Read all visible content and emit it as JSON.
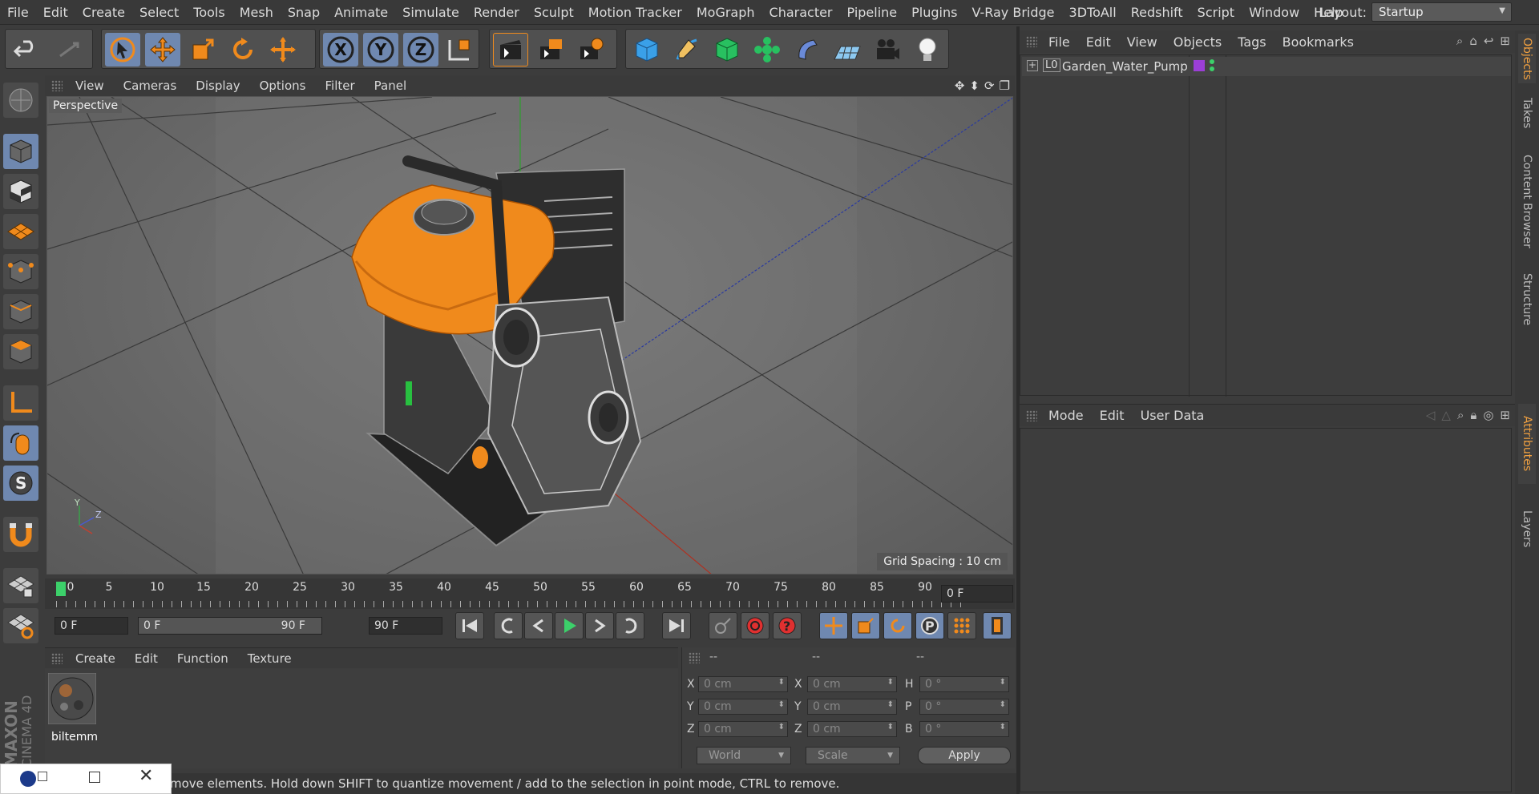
{
  "menubar": {
    "items": [
      "File",
      "Edit",
      "Create",
      "Select",
      "Tools",
      "Mesh",
      "Snap",
      "Animate",
      "Simulate",
      "Render",
      "Sculpt",
      "Motion Tracker",
      "MoGraph",
      "Character",
      "Pipeline",
      "Plugins",
      "V-Ray Bridge",
      "3DToAll",
      "Redshift",
      "Script",
      "Window",
      "Help"
    ],
    "layout_label": "Layout:",
    "layout_value": "Startup"
  },
  "toolbar": {
    "axis_x": "X",
    "axis_y": "Y",
    "axis_z": "Z"
  },
  "viewport": {
    "menu": [
      "View",
      "Cameras",
      "Display",
      "Options",
      "Filter",
      "Panel"
    ],
    "label": "Perspective",
    "grid_spacing": "Grid Spacing : 10 cm",
    "axis_y": "Y",
    "axis_z": "Z"
  },
  "timeline": {
    "ticks": [
      "0",
      "5",
      "10",
      "15",
      "20",
      "25",
      "30",
      "35",
      "40",
      "45",
      "50",
      "55",
      "60",
      "65",
      "70",
      "75",
      "80",
      "85",
      "90"
    ],
    "current_frame": "0 F"
  },
  "transport": {
    "start_frame": "0 F",
    "range_start": "0 F",
    "range_end": "90 F",
    "end_frame": "90 F"
  },
  "material_manager": {
    "menu": [
      "Create",
      "Edit",
      "Function",
      "Texture"
    ],
    "material_name": "biltemm"
  },
  "coordinates": {
    "headers": [
      "--",
      "--",
      "--"
    ],
    "rows": [
      {
        "l1": "X",
        "v1": "0 cm",
        "l2": "X",
        "v2": "0 cm",
        "l3": "H",
        "v3": "0 °"
      },
      {
        "l1": "Y",
        "v1": "0 cm",
        "l2": "Y",
        "v2": "0 cm",
        "l3": "P",
        "v3": "0 °"
      },
      {
        "l1": "Z",
        "v1": "0 cm",
        "l2": "Z",
        "v2": "0 cm",
        "l3": "B",
        "v3": "0 °"
      }
    ],
    "world": "World",
    "scale": "Scale",
    "apply": "Apply"
  },
  "status": {
    "text": "move elements. Hold down SHIFT to quantize movement / add to the selection in point mode, CTRL to remove."
  },
  "object_manager": {
    "menu": [
      "File",
      "Edit",
      "View",
      "Objects",
      "Tags",
      "Bookmarks"
    ],
    "object_name": "Garden_Water_Pump",
    "layer_flag": "L0"
  },
  "attribute_manager": {
    "menu": [
      "Mode",
      "Edit",
      "User Data"
    ]
  },
  "side_tabs": [
    "Objects",
    "Takes",
    "Content Browser",
    "Structure",
    "Attributes",
    "Layers"
  ],
  "brand": {
    "maxon": "MAXON",
    "cinema": "CINEMA 4D"
  },
  "colors": {
    "accent_active": "#6f88b0",
    "orange": "#f08a1c",
    "object_color": "#9b3fd6"
  }
}
